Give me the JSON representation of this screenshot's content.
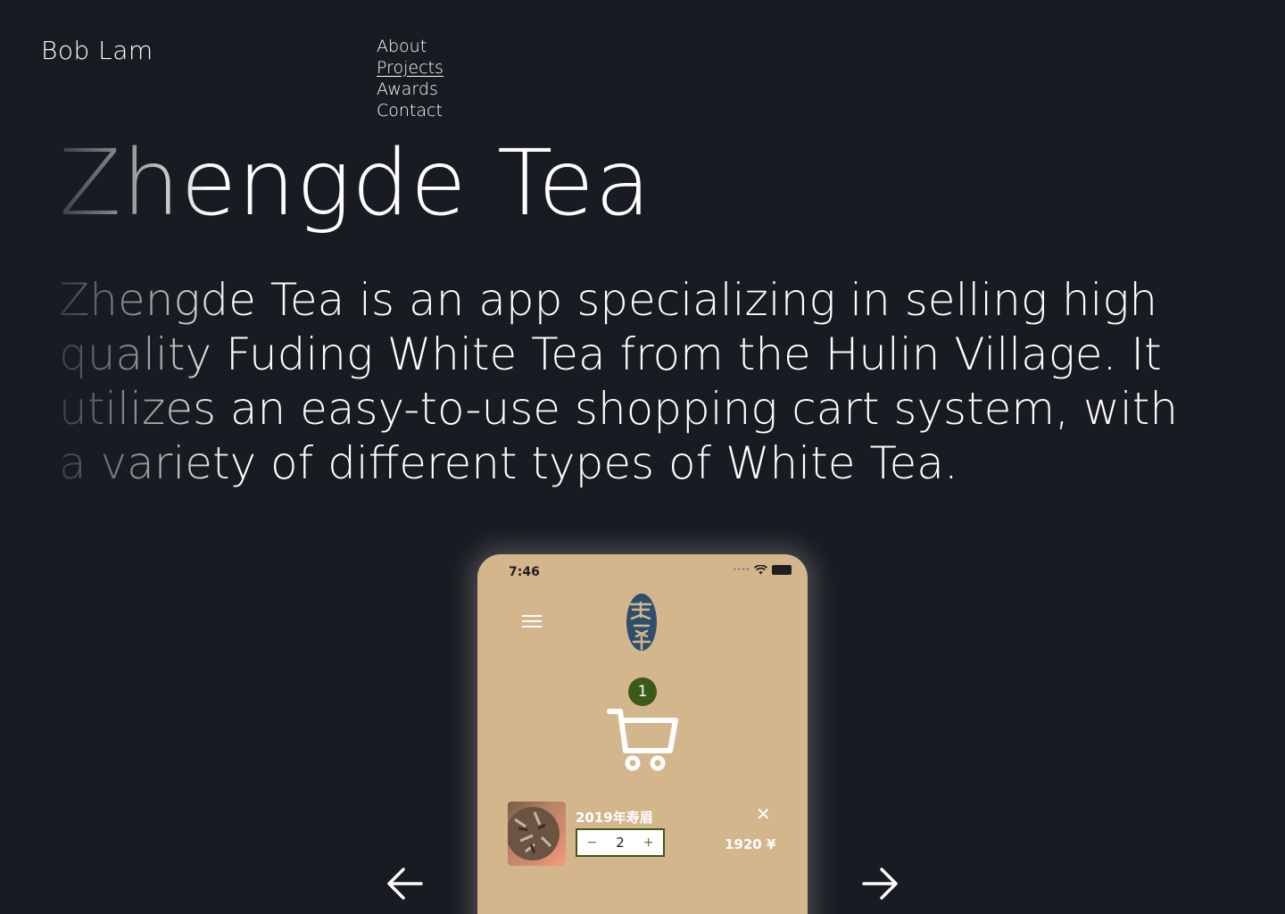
{
  "header": {
    "brand": "Bob Lam",
    "nav": [
      "About",
      "Projects",
      "Awards",
      "Contact"
    ],
    "active_nav": "Projects"
  },
  "hero": {
    "title": "Zhengde Tea",
    "description": "Zhengde Tea is an app specializing in selling high quality Fuding White Tea from the Hulin Village. It utilizes an easy-to-use shopping cart system, with a variety of different types of White Tea."
  },
  "phone": {
    "status_time": "7:46",
    "cart_count": "1",
    "item": {
      "name": "2019年寿眉",
      "quantity": "2",
      "minus": "−",
      "plus": "+",
      "price": "1920 ¥",
      "remove": "✕"
    }
  },
  "colors": {
    "background": "#191b22",
    "phone_bg": "#d4b68d",
    "accent_green": "#3b5a18",
    "logo_blue": "#2d4f6b"
  },
  "icons": {
    "menu": "hamburger-icon",
    "cart": "shopping-cart-icon",
    "prev": "arrow-left-icon",
    "next": "arrow-right-icon"
  }
}
